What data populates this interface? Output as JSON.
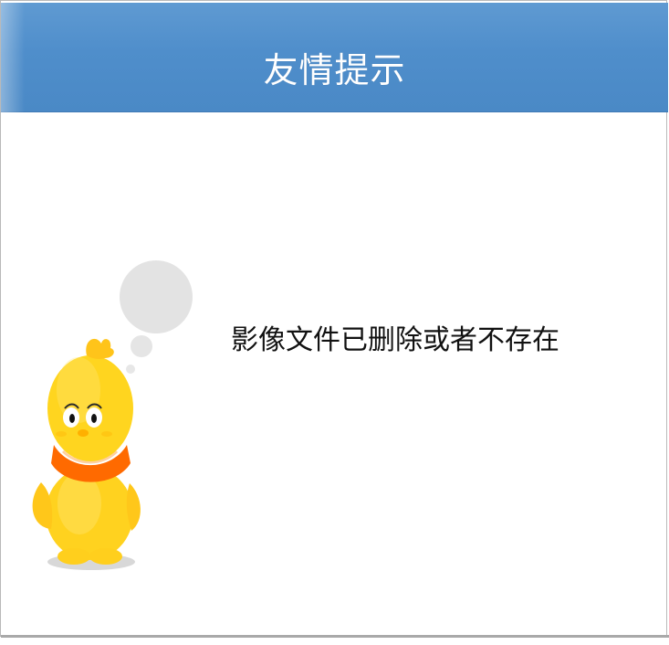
{
  "dialog": {
    "title": "友情提示",
    "message": "影像文件已删除或者不存在"
  },
  "mascot": {
    "icon": "yellow-chick-thinking-icon",
    "colors": {
      "body": "#ffd21f",
      "scarf": "#ff6a00",
      "bubble": "#e2e2e2"
    }
  },
  "theme": {
    "header": "#4f8ecb",
    "title_text": "#ffffff",
    "message_text": "#111111"
  }
}
